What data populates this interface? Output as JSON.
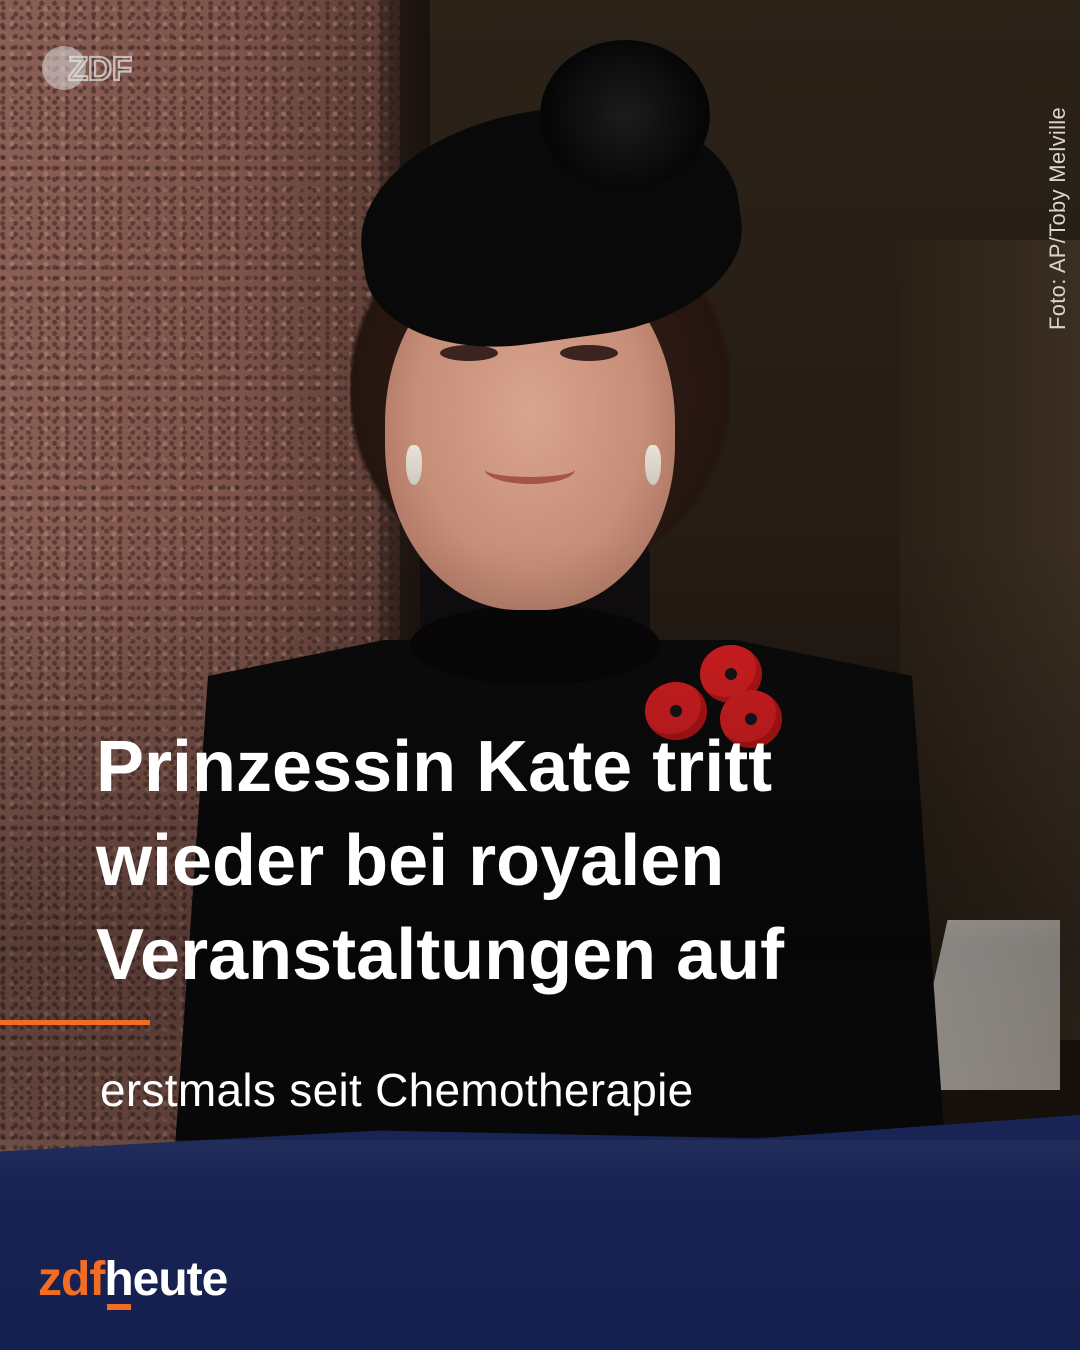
{
  "colors": {
    "accent": "#f26d21",
    "text": "#ffffff",
    "credit": "#d9d4cf",
    "banner": "#1f2d6b"
  },
  "corner_logo": {
    "icon": "zdf-logo-icon",
    "text": "ZDF"
  },
  "photo_credit": "Foto: AP/Toby Melville",
  "headline": {
    "line1": "Prinzessin Kate tritt",
    "line2": "wieder bei royalen",
    "line3": "Veranstaltungen auf"
  },
  "subline": "erstmals seit Chemotherapie",
  "brand": {
    "part1": "zdf",
    "part2": "heute"
  }
}
